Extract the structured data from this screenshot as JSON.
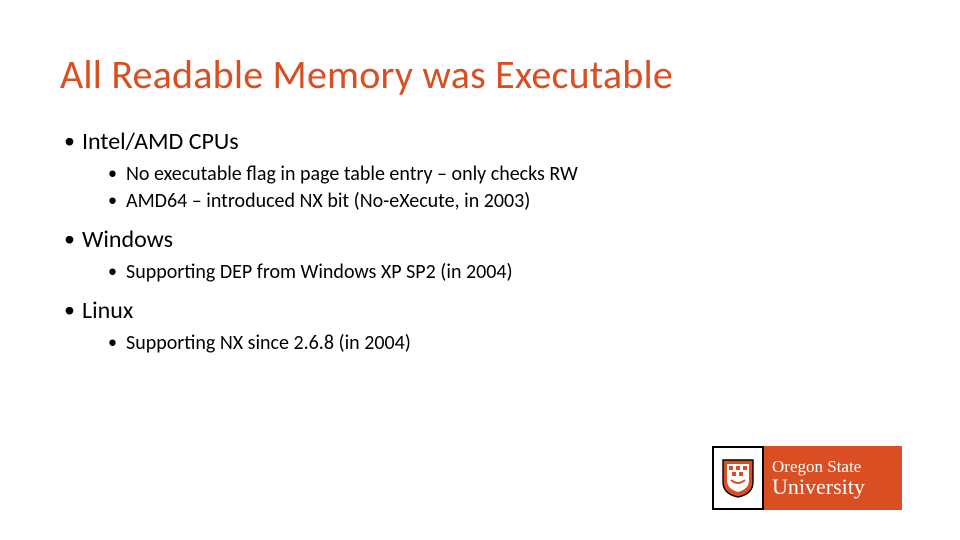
{
  "title": "All Readable Memory was Executable",
  "bullets": [
    {
      "text": "Intel/AMD CPUs",
      "sub": [
        "No executable flag in page table entry – only checks RW",
        "AMD64 – introduced NX bit (No-eXecute, in 2003)"
      ]
    },
    {
      "text": "Windows",
      "sub": [
        "Supporting DEP from Windows XP SP2 (in 2004)"
      ]
    },
    {
      "text": "Linux",
      "sub": [
        "Supporting NX since 2.6.8 (in 2004)"
      ]
    }
  ],
  "logo": {
    "line1": "Oregon State",
    "line2": "University"
  }
}
